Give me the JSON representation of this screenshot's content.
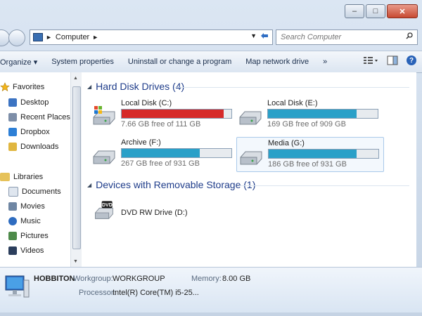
{
  "window": {
    "controls": [
      "‒",
      "□",
      "✕"
    ]
  },
  "address": {
    "crumb": "Computer",
    "separator": "►",
    "dropdown": "▼"
  },
  "search": {
    "placeholder": "Search Computer"
  },
  "toolbar": {
    "organize": "Organize ▾",
    "system_properties": "System properties",
    "uninstall": "Uninstall or change a program",
    "map_drive": "Map network drive",
    "more": "»",
    "help": "?"
  },
  "nav": {
    "favorites": {
      "label": "Favorites",
      "items": [
        "Desktop",
        "Recent Places",
        "Dropbox",
        "Downloads"
      ]
    },
    "libraries": {
      "label": "Libraries",
      "items": [
        "Documents",
        "Movies",
        "Music",
        "Pictures",
        "Videos"
      ]
    }
  },
  "groups": {
    "hard_disks": "Hard Disk Drives (4)",
    "removable": "Devices with Removable Storage (1)"
  },
  "drives": [
    {
      "name": "Local Disk (C:)",
      "free": "7.66 GB free of 111 GB",
      "used_fraction": 0.93,
      "color": "#d62a2a"
    },
    {
      "name": "Local Disk (E:)",
      "free": "169 GB free of 909 GB",
      "used_fraction": 0.81,
      "color": "#2aa0c8"
    },
    {
      "name": "Archive (F:)",
      "free": "267 GB free of 931 GB",
      "used_fraction": 0.71,
      "color": "#2aa0c8"
    },
    {
      "name": "Media (G:)",
      "free": "186 GB free of 931 GB",
      "used_fraction": 0.8,
      "color": "#2aa0c8"
    }
  ],
  "removable": {
    "name": "DVD RW Drive (D:)",
    "badge": "DVD"
  },
  "details": {
    "computer_name": "HOBBITON",
    "workgroup_label": "Workgroup:",
    "workgroup": "WORKGROUP",
    "memory_label": "Memory:",
    "memory": "8.00 GB",
    "processor_label": "Processor:",
    "processor": "Intel(R) Core(TM) i5-25..."
  }
}
